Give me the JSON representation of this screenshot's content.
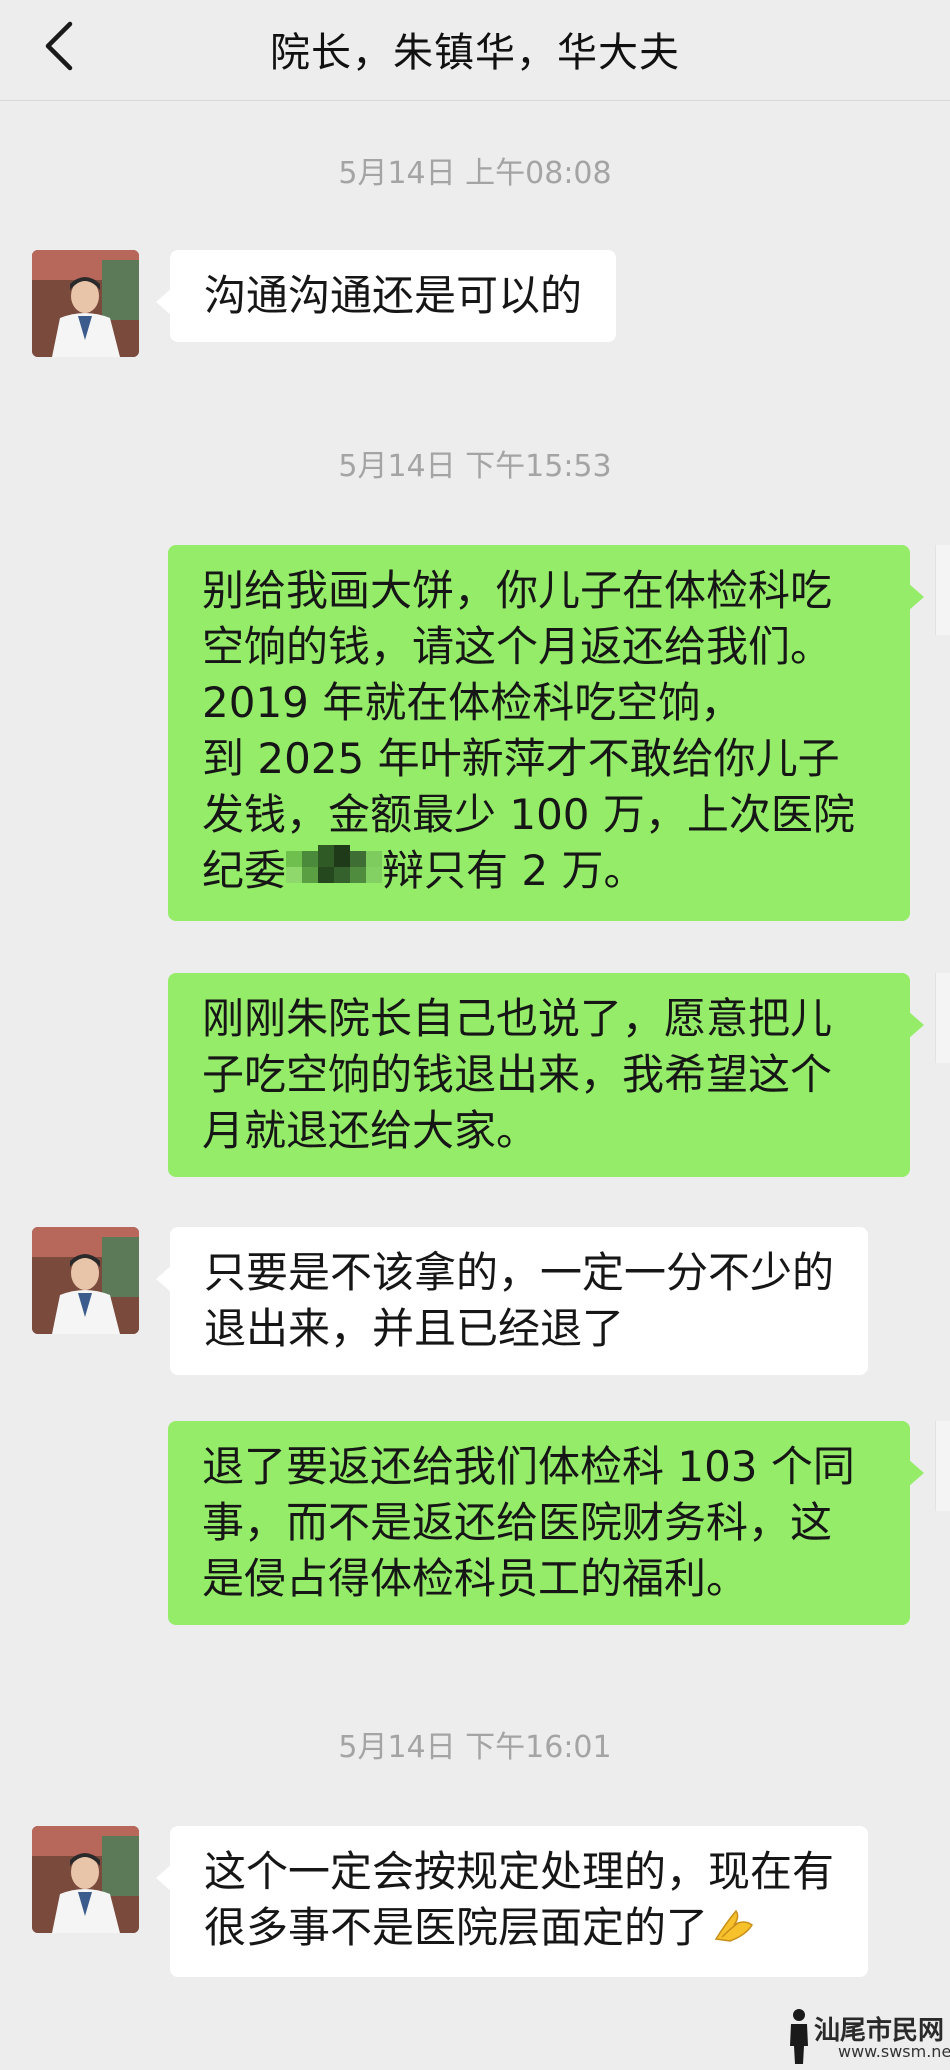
{
  "header": {
    "back_icon": "chevron-left-icon",
    "title": "院长，朱镇华，华大夫"
  },
  "messages": [
    {
      "type": "timestamp",
      "text": "5月14日 上午08:08"
    },
    {
      "type": "incoming",
      "lines": [
        "沟通沟通还是可以的"
      ]
    },
    {
      "type": "timestamp",
      "text": "5月14日 下午15:53"
    },
    {
      "type": "outgoing",
      "lines": [
        "别给我画大饼，你儿子在体检科吃",
        "空饷的钱，请这个月返还给我们。",
        "2019 年就在体检科吃空饷，",
        "到 2025 年叶新萍才不敢给你儿子",
        "发钱，金额最少 100 万，上次医院",
        "纪委",
        "辩只有 2 万。"
      ]
    },
    {
      "type": "outgoing",
      "lines": [
        "刚刚朱院长自己也说了，愿意把儿",
        "子吃空饷的钱退出来，我希望这个",
        "月就退还给大家。"
      ]
    },
    {
      "type": "incoming",
      "lines": [
        "只要是不该拿的，一定一分不少的",
        "退出来，并且已经退了"
      ]
    },
    {
      "type": "outgoing",
      "lines": [
        "退了要返还给我们体检科 103 个同",
        "事，而不是返还给医院财务科，这",
        "是侵占得体检科员工的福利。"
      ]
    },
    {
      "type": "timestamp",
      "text": "5月14日 下午16:01"
    },
    {
      "type": "incoming",
      "lines": [
        "这个一定会按规定处理的，现在有",
        "很多事不是医院层面定的了"
      ],
      "emoji": "bowing-hands-icon"
    }
  ],
  "watermark": {
    "text": "汕尾市民网",
    "url": "www.swsm.net"
  },
  "colors": {
    "background": "#ededed",
    "incoming_bubble": "#ffffff",
    "outgoing_bubble": "#95ec69",
    "timestamp": "#a4a4a4"
  }
}
